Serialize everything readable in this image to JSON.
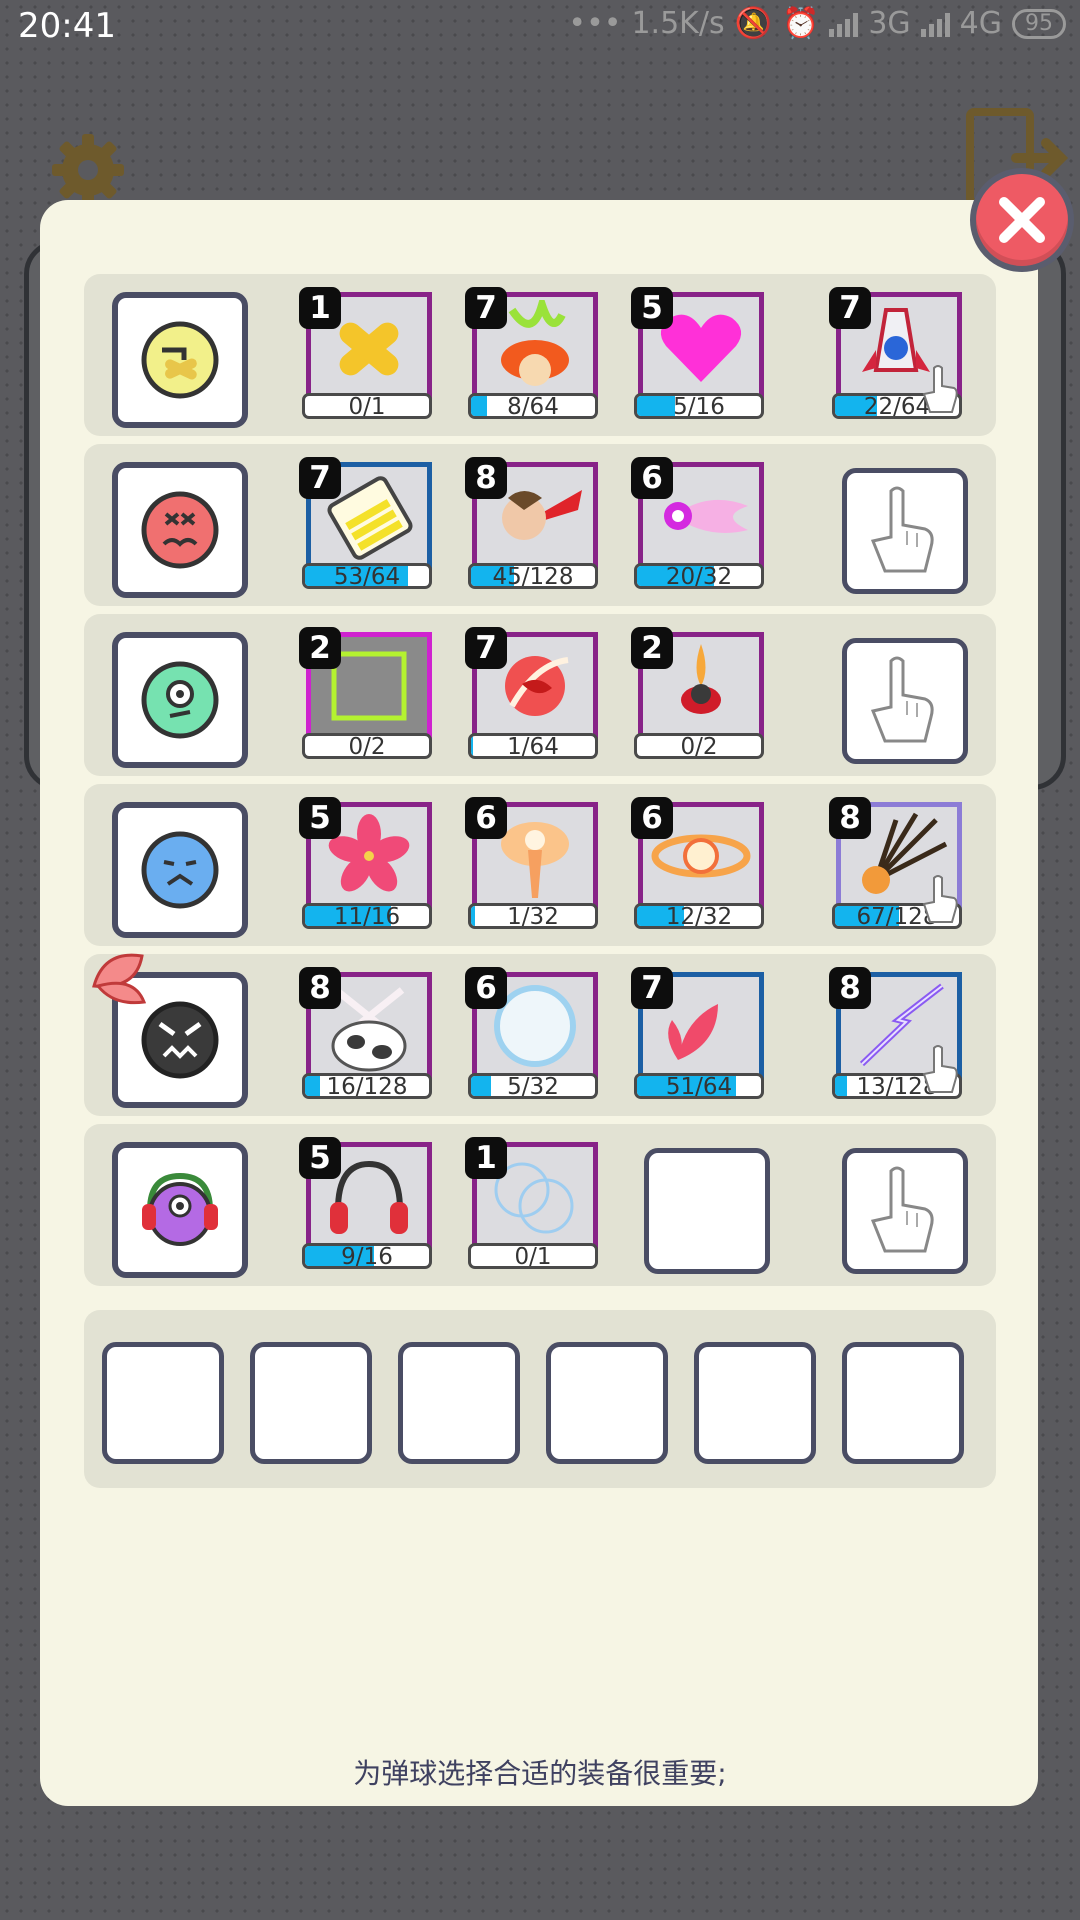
{
  "status": {
    "time": "20:41",
    "dots": "•••",
    "net_speed": "1.5K/s",
    "net_3g": "3G",
    "net_4g": "4G",
    "battery": "95"
  },
  "colors": {
    "accent_progress": "#13b4ee",
    "frame_purple": "#882388",
    "frame_blue": "#1c5fa4",
    "close_red": "#ee5a64"
  },
  "rows": [
    {
      "ball": "yellow-mouth-covered-ball-icon",
      "items": [
        {
          "level": "1",
          "progress": "0/1",
          "fill": 0.0,
          "icon": "bandage-icon"
        },
        {
          "level": "7",
          "progress": "8/64",
          "fill": 0.125,
          "icon": "fire-burst-icon"
        },
        {
          "level": "5",
          "progress": "5/16",
          "fill": 0.31,
          "icon": "heart-icon"
        },
        {
          "level": "7",
          "progress": "22/64",
          "fill": 0.34,
          "icon": "rocket-icon"
        }
      ]
    },
    {
      "ball": "red-angry-ball-icon",
      "items": [
        {
          "level": "7",
          "progress": "53/64",
          "fill": 0.83,
          "icon": "battery-icon"
        },
        {
          "level": "8",
          "progress": "45/128",
          "fill": 0.35,
          "icon": "bird-fire-icon"
        },
        {
          "level": "6",
          "progress": "20/32",
          "fill": 0.62,
          "icon": "magenta-comet-icon"
        }
      ],
      "empty_slot": "hand-pointer-icon"
    },
    {
      "ball": "green-one-eye-ball-icon",
      "items": [
        {
          "level": "2",
          "progress": "0/2",
          "fill": 0.0,
          "icon": "glowing-square-icon"
        },
        {
          "level": "7",
          "progress": "1/64",
          "fill": 0.02,
          "icon": "red-slash-icon"
        },
        {
          "level": "2",
          "progress": "0/2",
          "fill": 0.0,
          "icon": "jetpack-icon"
        }
      ],
      "empty_slot": "hand-pointer-icon"
    },
    {
      "ball": "blue-sad-ball-icon",
      "items": [
        {
          "level": "5",
          "progress": "11/16",
          "fill": 0.69,
          "icon": "pink-flower-icon"
        },
        {
          "level": "6",
          "progress": "1/32",
          "fill": 0.03,
          "icon": "explosion-icon"
        },
        {
          "level": "6",
          "progress": "12/32",
          "fill": 0.38,
          "icon": "orbit-ring-icon"
        },
        {
          "level": "8",
          "progress": "67/128",
          "fill": 0.52,
          "icon": "shatter-burst-icon"
        }
      ]
    },
    {
      "ball": "black-angry-ball-with-leaf-icon",
      "items": [
        {
          "level": "8",
          "progress": "16/128",
          "fill": 0.12,
          "icon": "cow-swords-icon"
        },
        {
          "level": "6",
          "progress": "5/32",
          "fill": 0.16,
          "icon": "bubble-ring-icon"
        },
        {
          "level": "7",
          "progress": "51/64",
          "fill": 0.8,
          "icon": "red-leaves-icon"
        },
        {
          "level": "8",
          "progress": "13/128",
          "fill": 0.1,
          "icon": "lightning-icon"
        }
      ]
    },
    {
      "ball": "purple-headphone-ball-icon",
      "items": [
        {
          "level": "5",
          "progress": "9/16",
          "fill": 0.56,
          "icon": "headphones-icon"
        },
        {
          "level": "1",
          "progress": "0/1",
          "fill": 0.0,
          "icon": "double-bubble-icon"
        }
      ],
      "empty_slot": "hand-pointer-icon"
    }
  ],
  "tip_text": "为弹球选择合适的装备很重要;"
}
